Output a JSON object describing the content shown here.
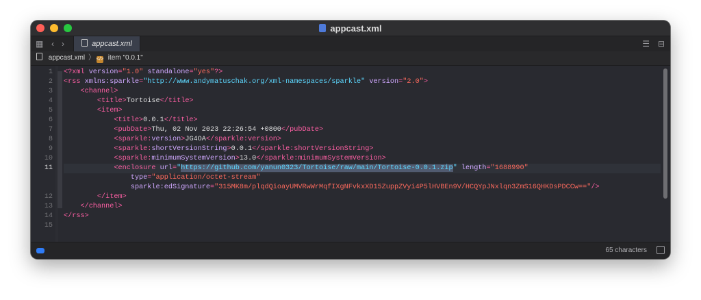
{
  "window": {
    "title": "appcast.xml"
  },
  "tabs": [
    {
      "label": "appcast.xml"
    }
  ],
  "jumpbar": {
    "file": "appcast.xml",
    "separator": "〉",
    "symbol": "item \"0.0.1\""
  },
  "editor": {
    "active_line": 11,
    "lines": [
      {
        "n": "1",
        "spans": [
          {
            "c": "tg",
            "t": "<?xml "
          },
          {
            "c": "at",
            "t": "version"
          },
          {
            "c": "tg",
            "t": "="
          },
          {
            "c": "av",
            "t": "\"1.0\""
          },
          {
            "c": "tx",
            "t": " "
          },
          {
            "c": "at",
            "t": "standalone"
          },
          {
            "c": "tg",
            "t": "="
          },
          {
            "c": "av",
            "t": "\"yes\""
          },
          {
            "c": "tg",
            "t": "?>"
          }
        ]
      },
      {
        "n": "2",
        "spans": [
          {
            "c": "tg",
            "t": "<rss "
          },
          {
            "c": "at",
            "t": "xmlns:sparkle"
          },
          {
            "c": "tg",
            "t": "="
          },
          {
            "c": "url",
            "t": "\"http://www.andymatuschak.org/xml-namespaces/sparkle\""
          },
          {
            "c": "tx",
            "t": " "
          },
          {
            "c": "at",
            "t": "version"
          },
          {
            "c": "tg",
            "t": "="
          },
          {
            "c": "av",
            "t": "\"2.0\""
          },
          {
            "c": "tg",
            "t": ">"
          }
        ]
      },
      {
        "n": "3",
        "spans": [
          {
            "c": "tx",
            "t": "    "
          },
          {
            "c": "tg",
            "t": "<channel>"
          }
        ]
      },
      {
        "n": "4",
        "spans": [
          {
            "c": "tx",
            "t": "        "
          },
          {
            "c": "tg",
            "t": "<title>"
          },
          {
            "c": "tx",
            "t": "Tortoise"
          },
          {
            "c": "tg",
            "t": "</title>"
          }
        ]
      },
      {
        "n": "5",
        "spans": [
          {
            "c": "tx",
            "t": "        "
          },
          {
            "c": "tg",
            "t": "<item>"
          }
        ]
      },
      {
        "n": "6",
        "spans": [
          {
            "c": "tx",
            "t": "            "
          },
          {
            "c": "tg",
            "t": "<title>"
          },
          {
            "c": "tx",
            "t": "0.0.1"
          },
          {
            "c": "tg",
            "t": "</title>"
          }
        ]
      },
      {
        "n": "7",
        "spans": [
          {
            "c": "tx",
            "t": "            "
          },
          {
            "c": "tg",
            "t": "<pubDate>"
          },
          {
            "c": "tx",
            "t": "Thu, 02 Nov 2023 22:26:54 +0800"
          },
          {
            "c": "tg",
            "t": "</pubDate>"
          }
        ]
      },
      {
        "n": "8",
        "spans": [
          {
            "c": "tx",
            "t": "            "
          },
          {
            "c": "tg",
            "t": "<sparkle:"
          },
          {
            "c": "at",
            "t": "version"
          },
          {
            "c": "tg",
            "t": ">"
          },
          {
            "c": "tx",
            "t": "JG4OA"
          },
          {
            "c": "tg",
            "t": "</sparkle:version>"
          }
        ]
      },
      {
        "n": "9",
        "spans": [
          {
            "c": "tx",
            "t": "            "
          },
          {
            "c": "tg",
            "t": "<sparkle:"
          },
          {
            "c": "at",
            "t": "shortVersionString"
          },
          {
            "c": "tg",
            "t": ">"
          },
          {
            "c": "tx",
            "t": "0.0.1"
          },
          {
            "c": "tg",
            "t": "</sparkle:shortVersionString>"
          }
        ]
      },
      {
        "n": "10",
        "spans": [
          {
            "c": "tx",
            "t": "            "
          },
          {
            "c": "tg",
            "t": "<sparkle:"
          },
          {
            "c": "at",
            "t": "minimumSystemVersion"
          },
          {
            "c": "tg",
            "t": ">"
          },
          {
            "c": "tx",
            "t": "13.0"
          },
          {
            "c": "tg",
            "t": "</sparkle:minimumSystemVersion>"
          }
        ]
      },
      {
        "n": "11",
        "spans": [
          {
            "c": "tx",
            "t": "            "
          },
          {
            "c": "tg",
            "t": "<enclosure "
          },
          {
            "c": "at",
            "t": "url"
          },
          {
            "c": "tg",
            "t": "="
          },
          {
            "c": "url",
            "t": "\""
          },
          {
            "c": "sel",
            "t": "https://github.com/yanun0323/Tortoise/raw/main/Tortoise-0.0.1.zip"
          },
          {
            "c": "url",
            "t": "\""
          },
          {
            "c": "tx",
            "t": " "
          },
          {
            "c": "at",
            "t": "length"
          },
          {
            "c": "tg",
            "t": "="
          },
          {
            "c": "av",
            "t": "\"1688990\""
          }
        ]
      },
      {
        "n": "",
        "spans": [
          {
            "c": "tx",
            "t": "                "
          },
          {
            "c": "at",
            "t": "type"
          },
          {
            "c": "tg",
            "t": "="
          },
          {
            "c": "av",
            "t": "\"application/octet-stream\""
          }
        ]
      },
      {
        "n": "",
        "spans": [
          {
            "c": "tx",
            "t": "                "
          },
          {
            "c": "at",
            "t": "sparkle:edSignature"
          },
          {
            "c": "tg",
            "t": "="
          },
          {
            "c": "av",
            "t": "\"315MK8m/plqdQioayUMVRwWrMqfIXgNFvkxXD15ZuppZVyi4P5lHVBEn9V/HCQYpJNxlqn3ZmS16QHKDsPDCCw==\""
          },
          {
            "c": "tg",
            "t": "/>"
          }
        ]
      },
      {
        "n": "12",
        "spans": [
          {
            "c": "tx",
            "t": "        "
          },
          {
            "c": "tg",
            "t": "</item>"
          }
        ]
      },
      {
        "n": "13",
        "spans": [
          {
            "c": "tx",
            "t": "    "
          },
          {
            "c": "tg",
            "t": "</channel>"
          }
        ]
      },
      {
        "n": "14",
        "spans": [
          {
            "c": "tg",
            "t": "</rss>"
          }
        ]
      },
      {
        "n": "15",
        "spans": []
      }
    ]
  },
  "status": {
    "char_count": "65 characters"
  },
  "colors": {
    "tag": "#fc5fa3",
    "attr": "#d0a8ff",
    "value": "#fc6a5d",
    "url": "#5dd8ff",
    "selection": "#515b70",
    "text": "#dfdfe0"
  },
  "icons": [
    "grid-icon",
    "back-arrow-icon",
    "forward-arrow-icon",
    "document-icon",
    "symbol-tag-icon",
    "inspector-icon",
    "split-editor-icon",
    "status-toggle-icon",
    "debug-area-icon"
  ]
}
